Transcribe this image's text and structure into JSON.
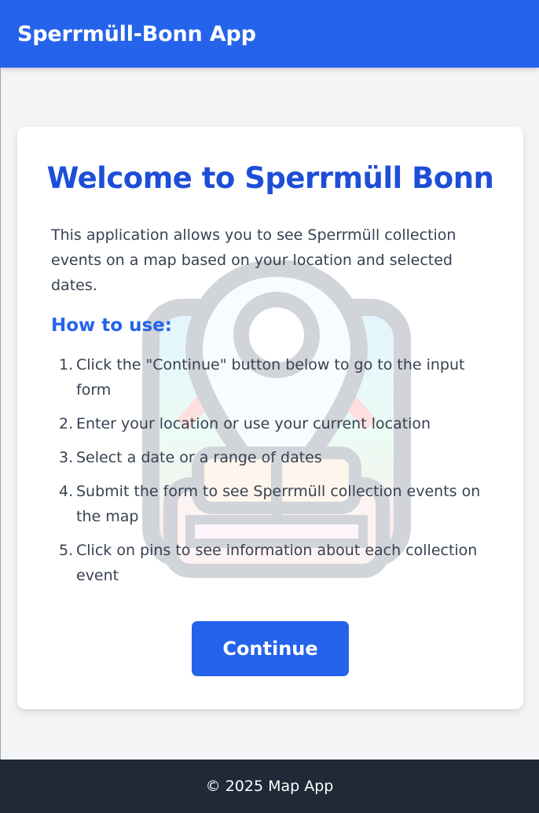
{
  "header": {
    "title": "Sperrmüll-Bonn App"
  },
  "welcome": {
    "title": "Welcome to Sperrmüll Bonn",
    "intro": "This application allows you to see Sperrmüll collection events on a map based on your location and selected dates.",
    "howto_heading": "How to use:",
    "watermark_icon": "map-pin-sofa-icon",
    "steps": [
      {
        "num": "1.",
        "text": "Click the \"Continue\" button below to go to the input form"
      },
      {
        "num": "2.",
        "text": "Enter your location or use your current location"
      },
      {
        "num": "3.",
        "text": "Select a date or a range of dates"
      },
      {
        "num": "4.",
        "text": "Submit the form to see Sperrmüll collection events on the map"
      },
      {
        "num": "5.",
        "text": "Click on pins to see information about each collection event"
      }
    ],
    "continue_label": "Continue"
  },
  "footer": {
    "text": "© 2025 Map App"
  },
  "colors": {
    "primary": "#2563eb",
    "title": "#1d4ed8",
    "footer_bg": "#1f2937",
    "page_bg": "#f3f4f6"
  }
}
